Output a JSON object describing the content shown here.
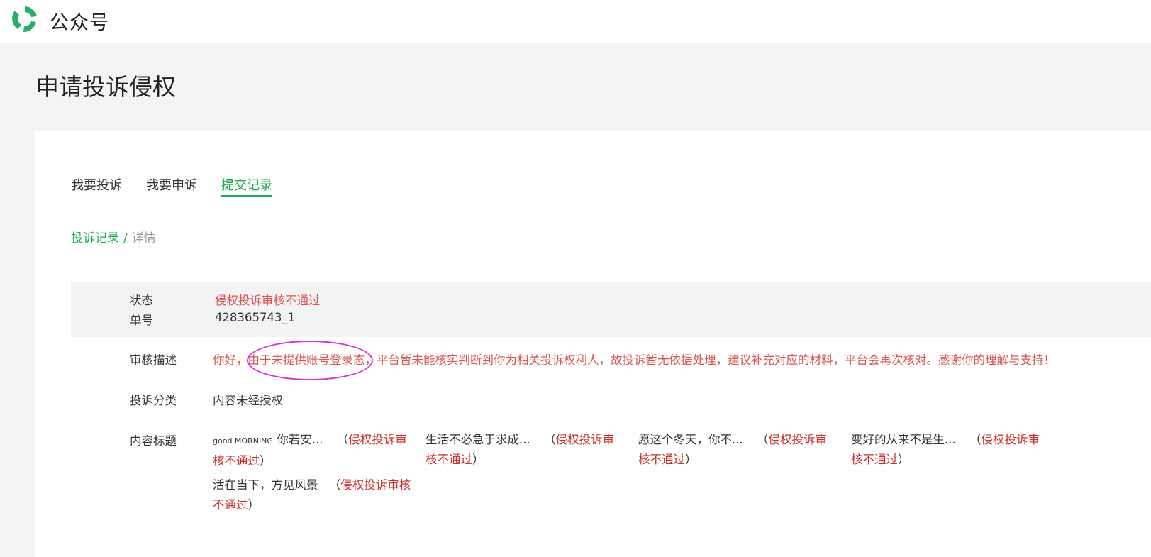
{
  "header": {
    "brand": "公众号"
  },
  "page_title": "申请投诉侵权",
  "tabs": [
    {
      "label": "我要投诉"
    },
    {
      "label": "我要申诉"
    },
    {
      "label": "提交记录",
      "active": true
    }
  ],
  "breadcrumb": {
    "link": "投诉记录",
    "separator": "/",
    "current": "详情"
  },
  "status": {
    "status_label": "状态",
    "status_value": "侵权投诉审核不通过",
    "number_label": "单号",
    "number_value": "428365743_1"
  },
  "review": {
    "label": "审核描述",
    "text": "你好，由于未提供账号登录态，平台暂未能核实判断到你为相关投诉权利人，故投诉暂无依据处理，建议补充对应的材料，平台会再次核对。感谢你的理解与支持！"
  },
  "category": {
    "label": "投诉分类",
    "value": "内容未经授权"
  },
  "content_titles": {
    "label": "内容标题",
    "items": [
      {
        "title_small": "good MORNING",
        "title": " 你若安...",
        "status_line1": "侵权投诉审",
        "status_line2": "核不通过"
      },
      {
        "title_small": "",
        "title": "生活不必急于求成...",
        "status_line1": "侵权投诉审",
        "status_line2": "核不通过"
      },
      {
        "title_small": "",
        "title": "愿这个冬天，你不...",
        "status_line1": "侵权投诉审",
        "status_line2": "核不通过"
      },
      {
        "title_small": "",
        "title": "变好的从来不是生...",
        "status_line1": "侵权投诉审",
        "status_line2": "核不通过"
      },
      {
        "title_small": "",
        "title": "活在当下，方见风景",
        "status_line1": "侵权投诉审核",
        "status_line2": "不通过"
      }
    ],
    "paren_open": "（",
    "paren_close": "）"
  },
  "colors": {
    "accent": "#1aad4e",
    "error": "#d9534f",
    "annotation": "#d633d6"
  },
  "icons": {
    "logo": "wechat-official-accounts-logo-icon"
  }
}
